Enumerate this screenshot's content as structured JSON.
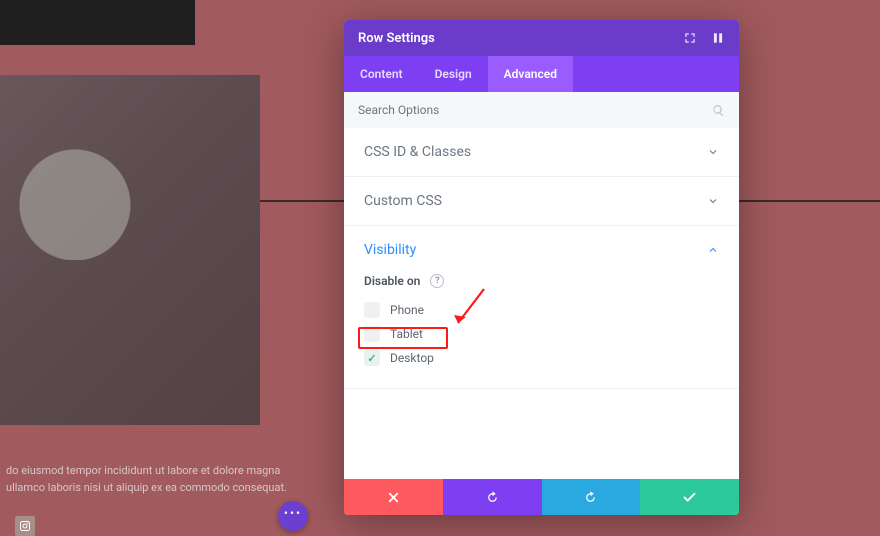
{
  "background": {
    "lorem_line1": "do eiusmod tempor incididunt ut labore et dolore magna",
    "lorem_line2": "ullamco laboris nisi ut aliquip ex ea commodo consequat.",
    "social_icon": "instagram-icon",
    "fab_label": "•••"
  },
  "modal": {
    "title": "Row Settings",
    "header_icons": {
      "expand": "expand-icon",
      "drag": "drag-icon"
    },
    "tabs": [
      {
        "id": "content",
        "label": "Content"
      },
      {
        "id": "design",
        "label": "Design"
      },
      {
        "id": "advanced",
        "label": "Advanced",
        "active": true
      }
    ],
    "search": {
      "placeholder": "Search Options",
      "icon": "search-icon"
    },
    "accordions": {
      "css_id": {
        "title": "CSS ID & Classes",
        "open": false
      },
      "custom_css": {
        "title": "Custom CSS",
        "open": false
      },
      "visibility": {
        "title": "Visibility",
        "open": true,
        "disable_on_label": "Disable on",
        "help": "?",
        "options": [
          {
            "label": "Phone",
            "checked": false
          },
          {
            "label": "Tablet",
            "checked": false
          },
          {
            "label": "Desktop",
            "checked": true
          }
        ]
      }
    },
    "footer": {
      "cancel": "close-icon",
      "undo": "undo-icon",
      "redo": "redo-icon",
      "confirm": "check-icon"
    }
  },
  "annotations": {
    "highlight_target": "visibility-option-desktop",
    "arrow": true
  }
}
